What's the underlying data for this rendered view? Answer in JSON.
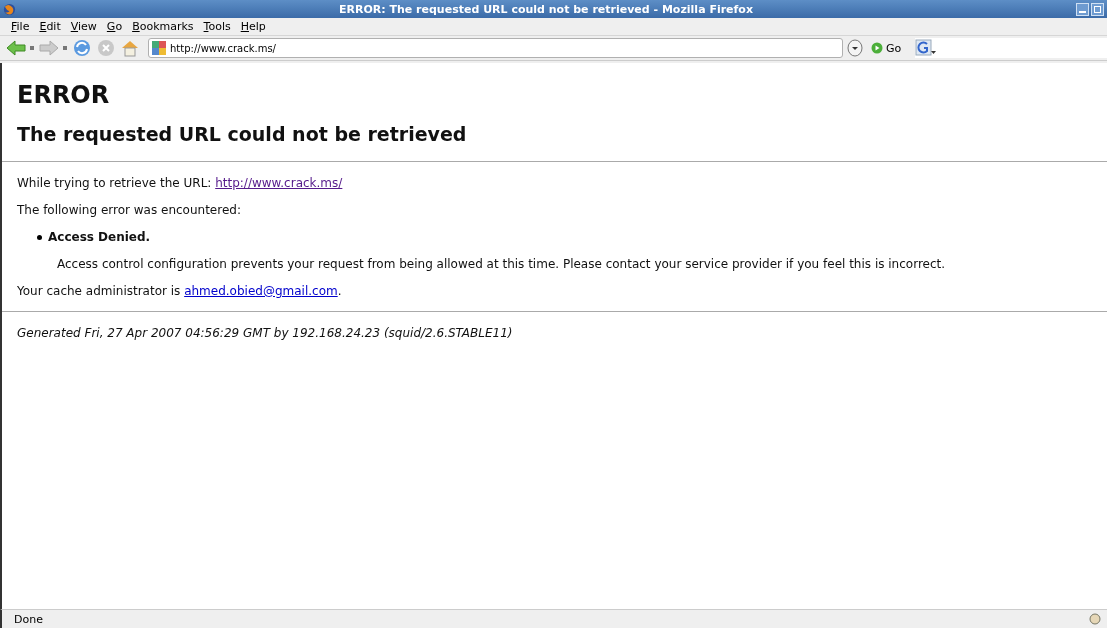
{
  "window": {
    "title": "ERROR: The requested URL could not be retrieved - Mozilla Firefox"
  },
  "menu": [
    "File",
    "Edit",
    "View",
    "Go",
    "Bookmarks",
    "Tools",
    "Help"
  ],
  "address_bar": {
    "value": "http://www.crack.ms/"
  },
  "go_button": "Go",
  "page": {
    "heading": "ERROR",
    "subheading": "The requested URL could not be retrieved",
    "retrieve": {
      "text": "While trying to retrieve the URL: ",
      "link": "http://www.crack.ms/",
      "visited": true
    },
    "error_intro": "The following error was encountered:",
    "error_title": "Access Denied.",
    "error_detail": "Access control configuration prevents your request from being allowed at this time. Please contact your service provider if you feel this is incorrect.",
    "admin": {
      "text": "Your cache administrator is ",
      "link": "ahmed.obied@gmail.com",
      "visited": false,
      "suffix": "."
    },
    "footer": "Generated Fri, 27 Apr 2007 04:56:29 GMT by 192.168.24.23 (squid/2.6.STABLE11)"
  },
  "status_bar": {
    "text": "Done"
  }
}
